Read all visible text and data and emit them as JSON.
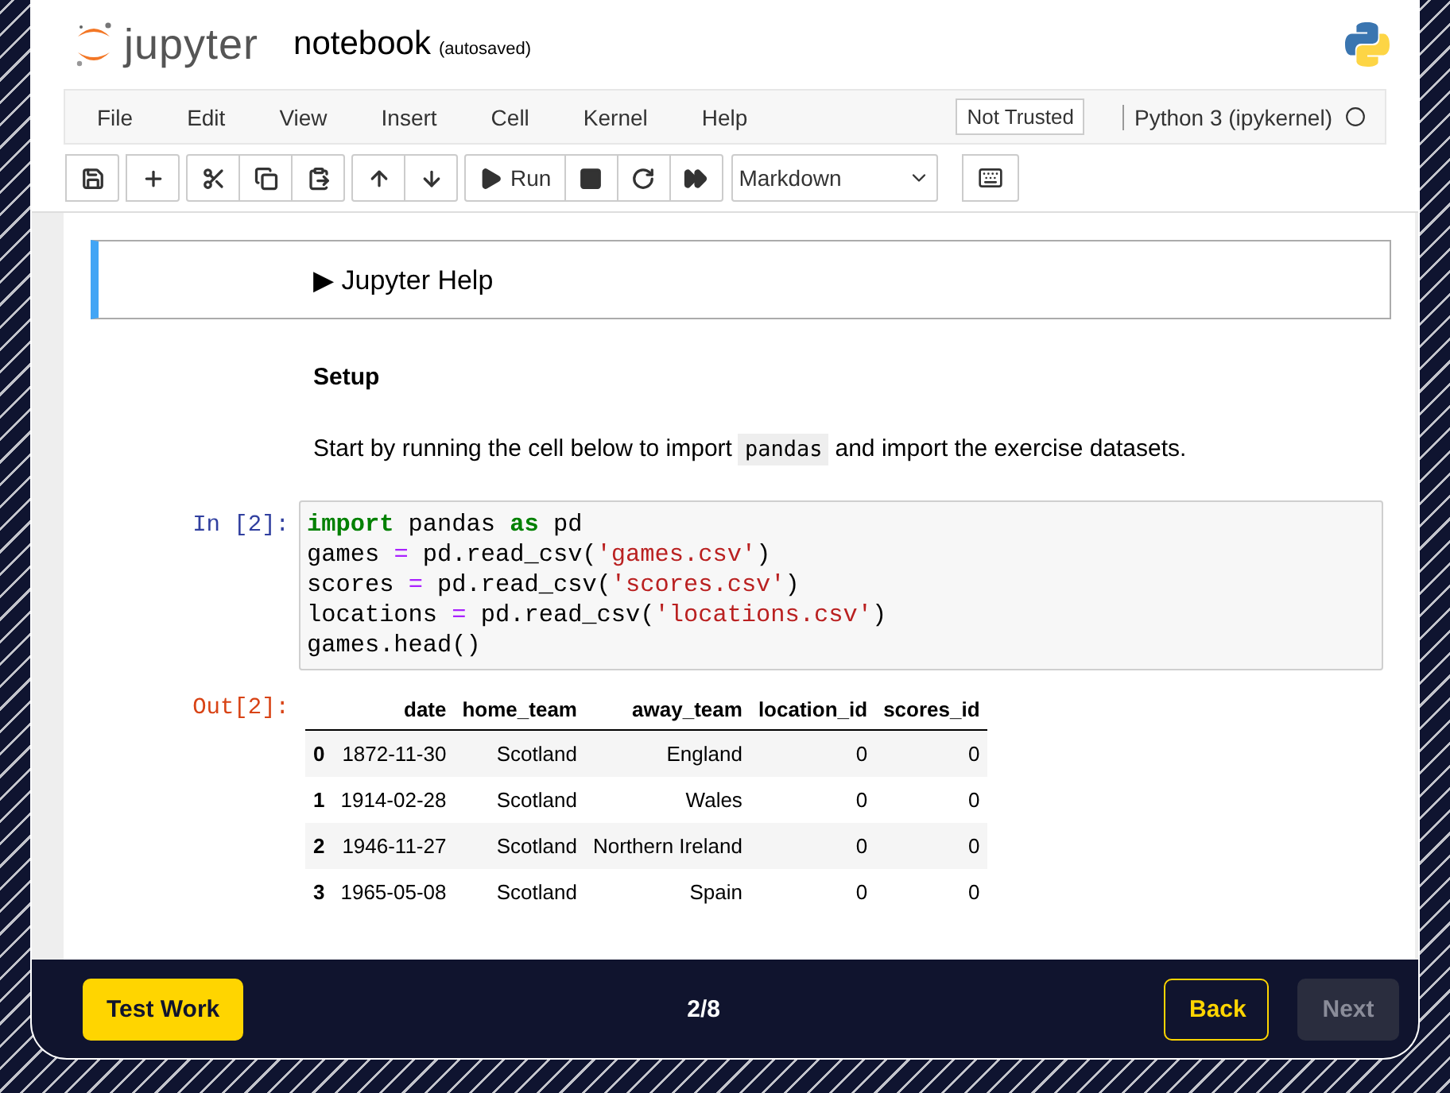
{
  "header": {
    "logo_text": "jupyter",
    "notebook_name": "notebook",
    "save_status": "(autosaved)"
  },
  "menubar": {
    "items": [
      "File",
      "Edit",
      "View",
      "Insert",
      "Cell",
      "Kernel",
      "Help"
    ],
    "trust_badge": "Not Trusted",
    "kernel_name": "Python 3 (ipykernel)"
  },
  "toolbar": {
    "run_label": "Run",
    "cell_type": "Markdown"
  },
  "cells": [
    {
      "kind": "help",
      "selected": true,
      "marker": "▶",
      "text": "Jupyter Help"
    },
    {
      "kind": "heading",
      "text": "Setup"
    },
    {
      "kind": "paragraph",
      "before": "Start by running the cell below to import",
      "code": "pandas",
      "after": "and import the exercise datasets."
    },
    {
      "kind": "code",
      "prompt": "In [2]:",
      "lines": [
        [
          {
            "text": "import",
            "kind": "keyword"
          },
          {
            "text": " pandas ",
            "kind": "plain"
          },
          {
            "text": "as",
            "kind": "keyword"
          },
          {
            "text": " pd",
            "kind": "plain"
          }
        ],
        [
          {
            "text": "games ",
            "kind": "plain"
          },
          {
            "text": "=",
            "kind": "op"
          },
          {
            "text": " pd.read_csv(",
            "kind": "plain"
          },
          {
            "text": "'games.csv'",
            "kind": "string"
          },
          {
            "text": ")",
            "kind": "plain"
          }
        ],
        [
          {
            "text": "scores ",
            "kind": "plain"
          },
          {
            "text": "=",
            "kind": "op"
          },
          {
            "text": " pd.read_csv(",
            "kind": "plain"
          },
          {
            "text": "'scores.csv'",
            "kind": "string"
          },
          {
            "text": ")",
            "kind": "plain"
          }
        ],
        [
          {
            "text": "locations ",
            "kind": "plain"
          },
          {
            "text": "=",
            "kind": "op"
          },
          {
            "text": " pd.read_csv(",
            "kind": "plain"
          },
          {
            "text": "'locations.csv'",
            "kind": "string"
          },
          {
            "text": ")",
            "kind": "plain"
          }
        ],
        [
          {
            "text": "games.head()",
            "kind": "plain"
          }
        ]
      ]
    },
    {
      "kind": "output",
      "prompt": "Out[2]:",
      "columns": [
        "date",
        "home_team",
        "away_team",
        "location_id",
        "scores_id"
      ],
      "rows": [
        {
          "index": "0",
          "cells": [
            "1872-11-30",
            "Scotland",
            "England",
            "0",
            "0"
          ]
        },
        {
          "index": "1",
          "cells": [
            "1914-02-28",
            "Scotland",
            "Wales",
            "0",
            "0"
          ]
        },
        {
          "index": "2",
          "cells": [
            "1946-11-27",
            "Scotland",
            "Northern Ireland",
            "0",
            "0"
          ]
        },
        {
          "index": "3",
          "cells": [
            "1965-05-08",
            "Scotland",
            "Spain",
            "0",
            "0"
          ]
        }
      ]
    }
  ],
  "footer": {
    "test_button": "Test Work",
    "progress": "2/8",
    "back_button": {
      "label": "Back",
      "disabled": false
    },
    "next_button": {
      "label": "Next",
      "disabled": true
    }
  }
}
